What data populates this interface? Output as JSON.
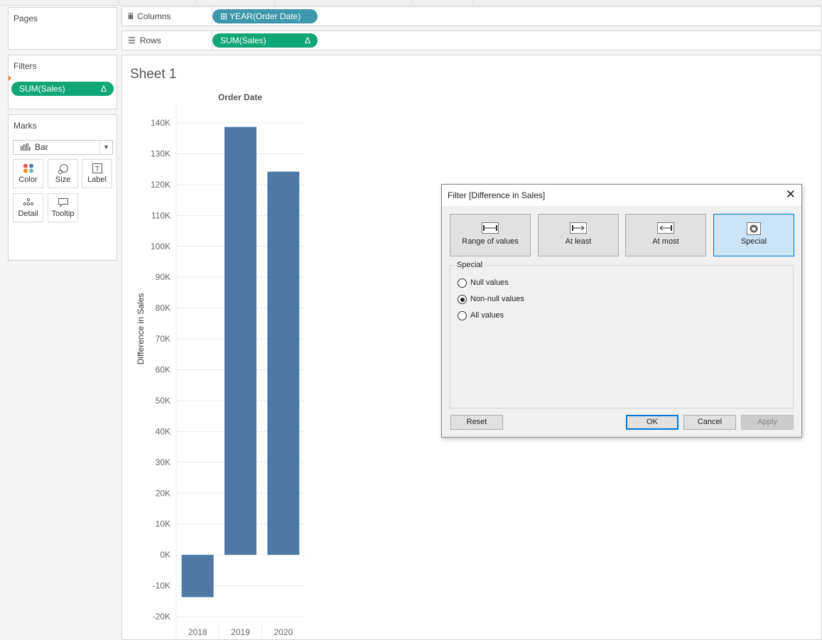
{
  "left_panel": {
    "pages_title": "Pages",
    "filters_title": "Filters",
    "filter_pill": "SUM(Sales)",
    "filter_pill_delta": "Δ",
    "marks_title": "Marks",
    "mark_type": "Bar",
    "mark_buttons": [
      "Color",
      "Size",
      "Label",
      "Detail",
      "Tooltip"
    ]
  },
  "shelves": {
    "columns_label": "Columns",
    "columns_pill": "⊞ YEAR(Order Date)",
    "rows_label": "Rows",
    "rows_pill": "SUM(Sales)",
    "rows_pill_delta": "Δ"
  },
  "sheet": {
    "title": "Sheet 1"
  },
  "chart_data": {
    "type": "bar",
    "title": "Order Date",
    "ylabel": "Difference in Sales",
    "xlabel": "",
    "categories": [
      "2018",
      "2019",
      "2020"
    ],
    "values": [
      -13700,
      138700,
      124200
    ],
    "ylim": [
      -20000,
      140000
    ],
    "yticks": [
      "140K",
      "130K",
      "120K",
      "110K",
      "100K",
      "90K",
      "80K",
      "70K",
      "60K",
      "50K",
      "40K",
      "30K",
      "20K",
      "10K",
      "0K",
      "-10K",
      "-20K"
    ],
    "ytick_values": [
      140000,
      130000,
      120000,
      110000,
      100000,
      90000,
      80000,
      70000,
      60000,
      50000,
      40000,
      30000,
      20000,
      10000,
      0,
      -10000,
      -20000
    ],
    "bar_color": "#4e79a7",
    "grid": true
  },
  "dialog": {
    "title": "Filter [Difference in Sales]",
    "close_glyph": "✕",
    "mode_buttons": [
      "Range of values",
      "At least",
      "At most",
      "Special"
    ],
    "active_mode": "Special",
    "group_title": "Special",
    "options": [
      "Null values",
      "Non-null values",
      "All values"
    ],
    "selected_option": "Non-null values",
    "reset": "Reset",
    "ok": "OK",
    "cancel": "Cancel",
    "apply": "Apply"
  },
  "colors": {
    "pill_green": "#10a676",
    "pill_teal": "#3e97ad",
    "active_blue": "#cce4f7",
    "focus_blue": "#0078d7"
  }
}
